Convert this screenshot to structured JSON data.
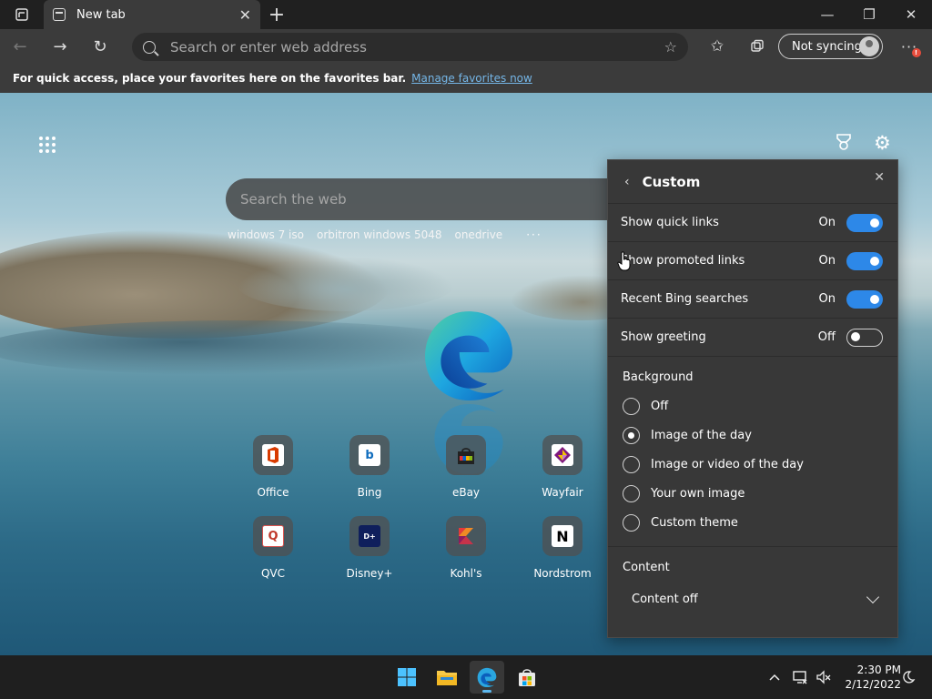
{
  "browser": {
    "tab_title": "New tab",
    "address_placeholder": "Search or enter web address",
    "profile_label": "Not syncing",
    "alert_badge": "!",
    "favorites_bar": {
      "message": "For quick access, place your favorites here on the favorites bar.",
      "link": "Manage favorites now"
    }
  },
  "newtab": {
    "search_placeholder": "Search the web",
    "recent_searches": [
      "windows 7 iso",
      "orbitron windows 5048",
      "onedrive"
    ],
    "quick_links": [
      {
        "label": "Office",
        "glyph": "O",
        "color": "#d83b01"
      },
      {
        "label": "Bing",
        "glyph": "b",
        "color": "#0f6cbd"
      },
      {
        "label": "eBay",
        "glyph": "",
        "color": "#222222"
      },
      {
        "label": "Wayfair",
        "glyph": "",
        "color": "#7f187f"
      },
      {
        "label": "QVC",
        "glyph": "Q",
        "color": "#d9534f"
      },
      {
        "label": "Disney+",
        "glyph": "D+",
        "color": "#0f1f5c"
      },
      {
        "label": "Kohl's",
        "glyph": "",
        "color": "#e5383b"
      },
      {
        "label": "Nordstrom",
        "glyph": "N",
        "color": "#000000"
      }
    ]
  },
  "panel": {
    "title": "Custom",
    "toggles": [
      {
        "label": "Show quick links",
        "state": "On"
      },
      {
        "label": "Show promoted links",
        "state": "On"
      },
      {
        "label": "Recent Bing searches",
        "state": "On"
      },
      {
        "label": "Show greeting",
        "state": "Off"
      }
    ],
    "background_title": "Background",
    "background_options": [
      "Off",
      "Image of the day",
      "Image or video of the day",
      "Your own image",
      "Custom theme"
    ],
    "background_selected": "Image of the day",
    "content_title": "Content",
    "content_value": "Content off"
  },
  "taskbar": {
    "time": "2:30 PM",
    "date": "2/12/2022"
  },
  "colors": {
    "accent": "#2d88e8",
    "link": "#75b6e7",
    "panel_bg": "#383838",
    "toolbar_bg": "#3b3b3b"
  }
}
